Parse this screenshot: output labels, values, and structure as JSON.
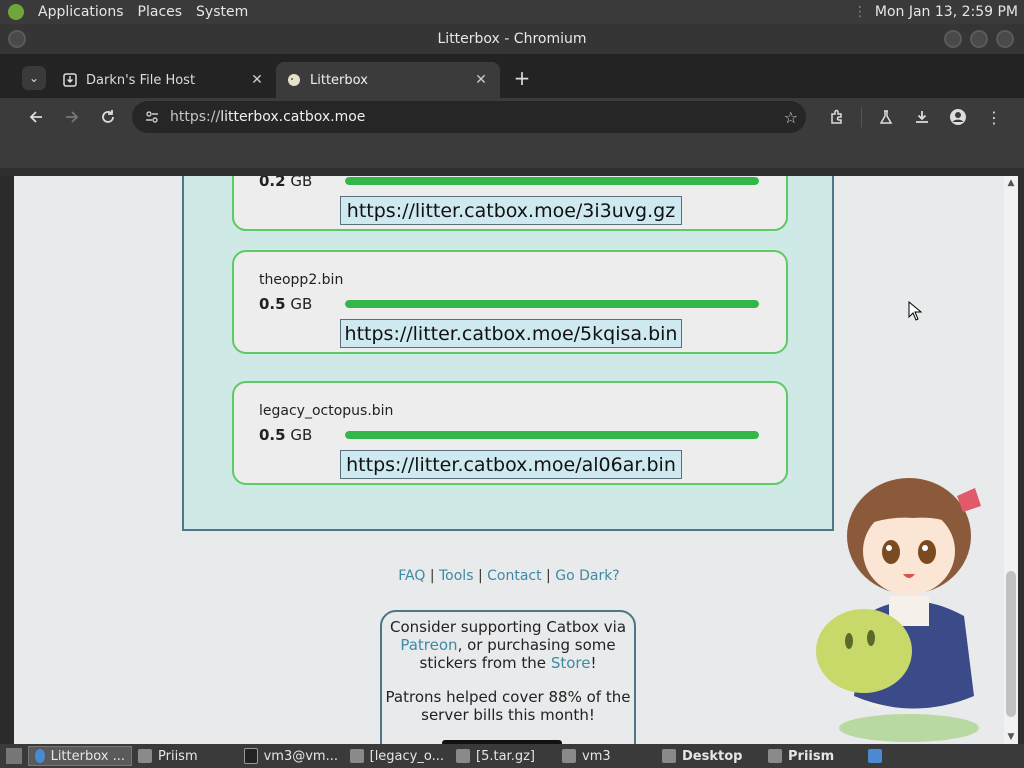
{
  "top_panel": {
    "menus": [
      "Applications",
      "Places",
      "System"
    ],
    "clock": "Mon Jan 13,  2:59 PM"
  },
  "window": {
    "title": "Litterbox - Chromium"
  },
  "tabs": [
    {
      "title": "Darkn's File Host",
      "icon": "download-icon",
      "close": "✕"
    },
    {
      "title": "Litterbox",
      "icon": "litterbox-favicon",
      "close": "✕"
    }
  ],
  "toolbar": {
    "url_scheme": "https://",
    "url_host": "litterbox.catbox.moe"
  },
  "files": [
    {
      "name": "",
      "size_value": "0.2",
      "size_unit": " GB",
      "progress": 1.0,
      "link": "https://litter.catbox.moe/3i3uvg.gz"
    },
    {
      "name": "theopp2.bin",
      "size_value": "0.5",
      "size_unit": " GB",
      "progress": 1.0,
      "link": "https://litter.catbox.moe/5kqisa.bin"
    },
    {
      "name": "legacy_octopus.bin",
      "size_value": "0.5",
      "size_unit": " GB",
      "progress": 1.0,
      "link": "https://litter.catbox.moe/al06ar.bin"
    }
  ],
  "footer": {
    "faq": "FAQ",
    "sep": " | ",
    "tools": "Tools",
    "contact": "Contact",
    "go_dark": "Go Dark?"
  },
  "support": {
    "line1": "Consider supporting Catbox via",
    "patreon": "Patreon",
    "line2": ", or purchasing some stickers from the ",
    "store": "Store",
    "line3": "!",
    "patrons": "Patrons helped cover 88% of the server bills this month!"
  },
  "taskbar": [
    {
      "label": "Litterbox ...",
      "active": true
    },
    {
      "label": "Priism",
      "active": false
    },
    {
      "label": "vm3@vm...",
      "active": false
    },
    {
      "label": "[legacy_o...",
      "active": false
    },
    {
      "label": "[5.tar.gz]",
      "active": false
    },
    {
      "label": "vm3",
      "active": false
    },
    {
      "label": "Desktop",
      "active": false,
      "bold": true
    },
    {
      "label": "Priism",
      "active": false,
      "bold": true
    }
  ],
  "colors": {
    "progress": "#33b64a",
    "card_border": "#5fca65",
    "link": "#3e8aa4",
    "panel_bg": "#cfe9e6"
  }
}
